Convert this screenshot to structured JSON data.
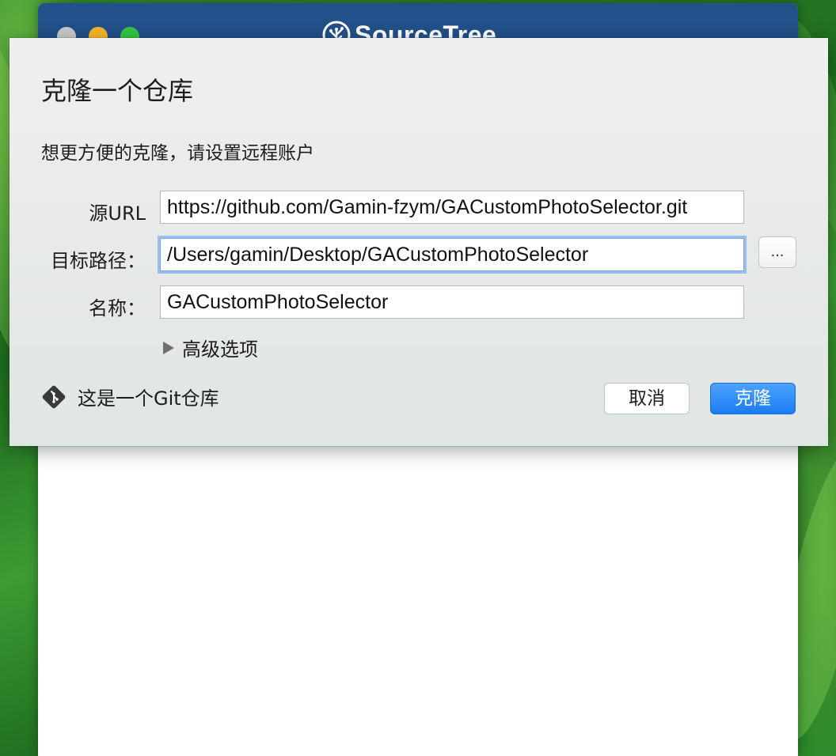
{
  "app": {
    "name": "SourceTree",
    "logo_icon": "tree-icon"
  },
  "dialog": {
    "title": "克隆一个仓库",
    "subtitle": "想更方便的克隆，请设置远程账户",
    "source_url": {
      "label": "源URL",
      "value": "https://github.com/Gamin-fzym/GACustomPhotoSelector.git"
    },
    "destination": {
      "label": "目标路径：",
      "value": "/Users/gamin/Desktop/GACustomPhotoSelector",
      "browse_label": "..."
    },
    "name": {
      "label": "名称：",
      "value": "GACustomPhotoSelector"
    },
    "advanced_label": "高级选项",
    "git_status": "这是一个Git仓库",
    "cancel_label": "取消",
    "clone_label": "克隆"
  },
  "colors": {
    "titlebar": "#22508a",
    "primary_button": "#1a7cf3",
    "focus_ring": "#9bbcf0"
  }
}
